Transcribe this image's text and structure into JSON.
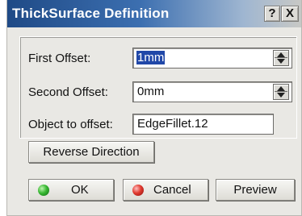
{
  "window": {
    "title": "ThickSurface Definition",
    "help_label": "?",
    "close_label": "X"
  },
  "form": {
    "first_offset": {
      "label": "First Offset:",
      "value": "1mm"
    },
    "second_offset": {
      "label": "Second Offset:",
      "value": "0mm"
    },
    "object_to_offset": {
      "label": "Object to offset:",
      "value": "EdgeFillet.12"
    }
  },
  "buttons": {
    "reverse": "Reverse Direction",
    "ok": "OK",
    "cancel": "Cancel",
    "preview": "Preview"
  },
  "icons": {
    "ok": "green-ball-icon",
    "cancel": "red-ball-icon",
    "spinner": "spinner-arrows-icon"
  },
  "colors": {
    "title_bar": "#1f4a86",
    "selection": "#2148a8",
    "ok_icon": "#39b833",
    "cancel_icon": "#e13a2f"
  }
}
